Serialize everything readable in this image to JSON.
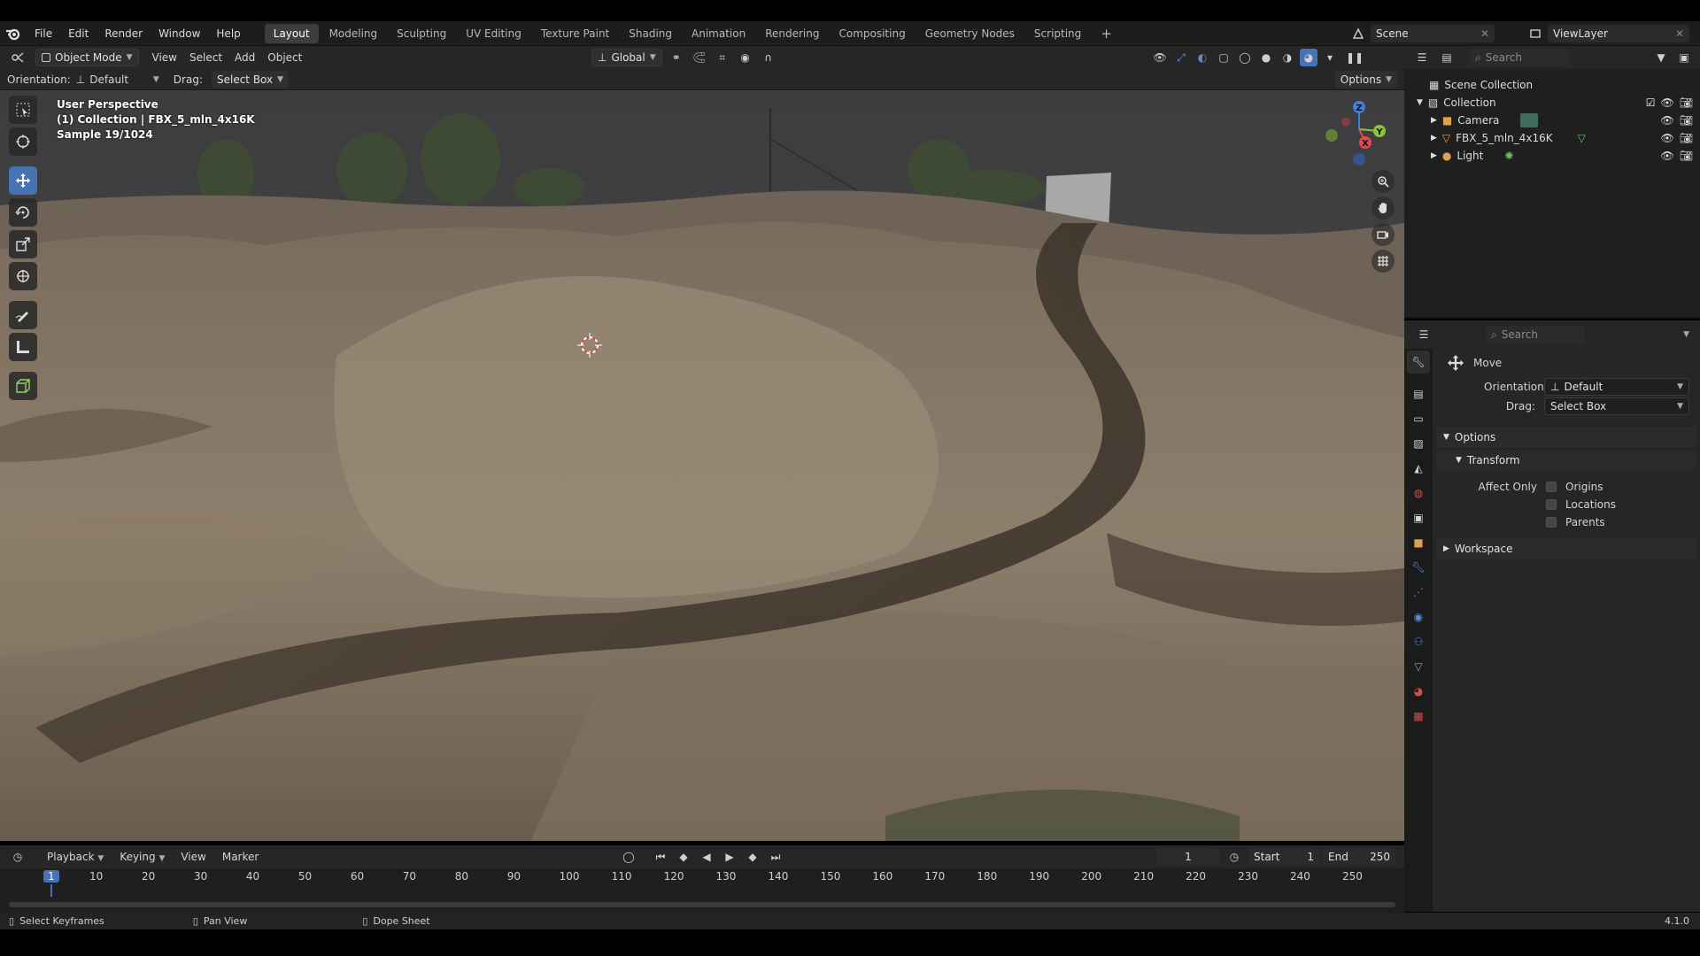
{
  "menubar": {
    "menus": [
      "File",
      "Edit",
      "Render",
      "Window",
      "Help"
    ],
    "workspace_tabs": [
      "Layout",
      "Modeling",
      "Sculpting",
      "UV Editing",
      "Texture Paint",
      "Shading",
      "Animation",
      "Rendering",
      "Compositing",
      "Geometry Nodes",
      "Scripting"
    ],
    "active_tab": "Layout",
    "scene": "Scene",
    "view_layer": "ViewLayer"
  },
  "viewport_header": {
    "mode": "Object Mode",
    "menus": [
      "View",
      "Select",
      "Add",
      "Object"
    ],
    "transform_orientation": "Global"
  },
  "tool_settings": {
    "orientation_label": "Orientation:",
    "orientation_value": "Default",
    "drag_label": "Drag:",
    "drag_value": "Select Box",
    "options": "Options"
  },
  "viewport_info": {
    "perspective": "User Perspective",
    "collection": "(1) Collection | FBX_5_mln_4x16K",
    "sample": "Sample 19/1024"
  },
  "gizmo": {
    "axes": [
      "Z",
      "Y",
      "X"
    ],
    "colors": {
      "x": "#e5474c",
      "y": "#8cc33c",
      "z": "#3f7fe0"
    }
  },
  "outliner": {
    "search_placeholder": "Search",
    "scene_collection": "Scene Collection",
    "collection": "Collection",
    "items": [
      {
        "name": "Camera",
        "icon": "camera-icon"
      },
      {
        "name": "FBX_5_mln_4x16K",
        "icon": "mesh-icon"
      },
      {
        "name": "Light",
        "icon": "light-icon"
      }
    ]
  },
  "properties": {
    "search_placeholder": "Search",
    "tool_name": "Move",
    "orientation_label": "Orientation",
    "orientation_value": "Default",
    "drag_label": "Drag:",
    "drag_value": "Select Box",
    "options_panel": "Options",
    "transform_panel": "Transform",
    "affect_only_label": "Affect Only",
    "affect_only": [
      "Origins",
      "Locations",
      "Parents"
    ],
    "workspace_panel": "Workspace"
  },
  "timeline": {
    "menus": [
      "Playback",
      "Keying",
      "View",
      "Marker"
    ],
    "current_frame": "1",
    "start_label": "Start",
    "start": "1",
    "end_label": "End",
    "end": "250",
    "ticks": [
      "1",
      "10",
      "20",
      "30",
      "40",
      "50",
      "60",
      "70",
      "80",
      "90",
      "100",
      "110",
      "120",
      "130",
      "140",
      "150",
      "160",
      "170",
      "180",
      "190",
      "200",
      "210",
      "220",
      "230",
      "240",
      "250"
    ]
  },
  "statusbar": {
    "select_keyframes": "Select Keyframes",
    "pan_view": "Pan View",
    "dope_sheet": "Dope Sheet",
    "version": "4.1.0"
  }
}
